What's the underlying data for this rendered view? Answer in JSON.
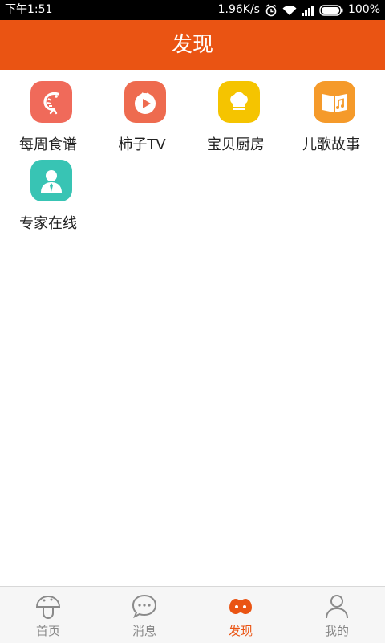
{
  "status_bar": {
    "time": "下午1:51",
    "net_speed": "1.96K/s",
    "battery": "100%"
  },
  "header": {
    "title": "发现"
  },
  "features": [
    {
      "label": "每周食谱",
      "icon": "shrimp-icon",
      "color": "#f06a5a"
    },
    {
      "label": "柿子TV",
      "icon": "tomato-play-icon",
      "color": "#ee6b4f"
    },
    {
      "label": "宝贝厨房",
      "icon": "chef-hat-icon",
      "color": "#f5c400"
    },
    {
      "label": "儿歌故事",
      "icon": "music-book-icon",
      "color": "#f59a2a"
    },
    {
      "label": "专家在线",
      "icon": "expert-icon",
      "color": "#38c4b4"
    }
  ],
  "tabs": [
    {
      "label": "首页",
      "icon": "mushroom-home-icon",
      "active": false
    },
    {
      "label": "消息",
      "icon": "chat-bubble-icon",
      "active": false
    },
    {
      "label": "发现",
      "icon": "discover-icon",
      "active": true
    },
    {
      "label": "我的",
      "icon": "user-icon",
      "active": false
    }
  ],
  "colors": {
    "accent": "#ea5413",
    "inactive": "#888888"
  }
}
